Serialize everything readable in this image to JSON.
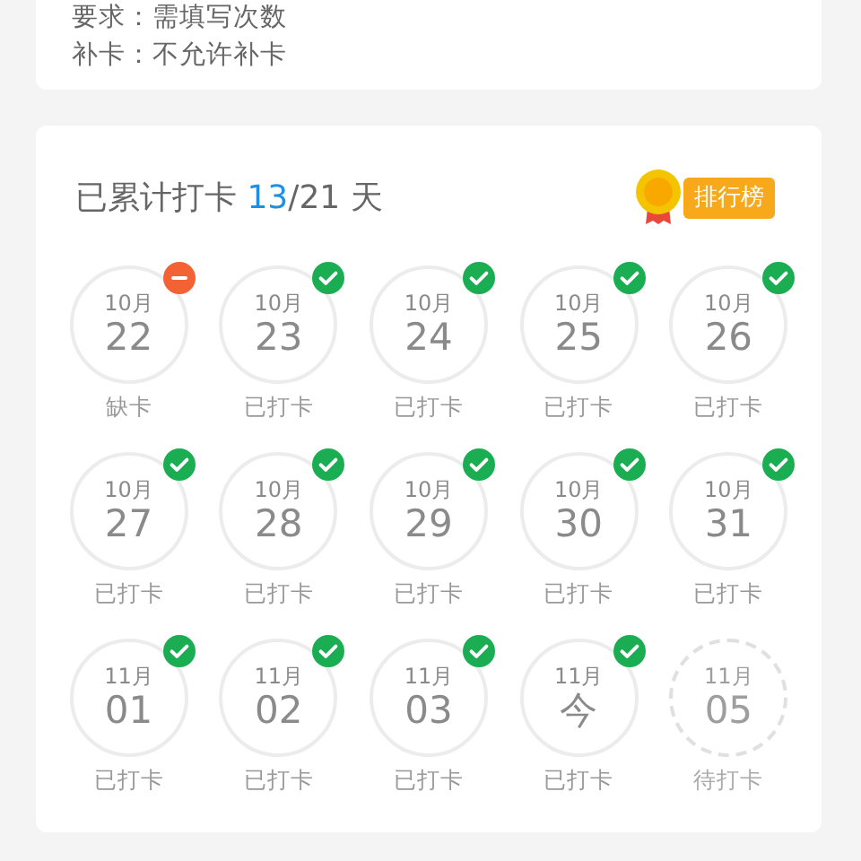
{
  "info_card": {
    "lines": [
      {
        "label": "要求：",
        "value": "需填写次数"
      },
      {
        "label": "补卡：",
        "value": "不允许补卡"
      }
    ]
  },
  "checkin": {
    "title_prefix": "已累计打卡",
    "done_count": "13",
    "total": "/21 天",
    "leaderboard_button": "排行榜",
    "days": [
      {
        "month": "10月",
        "day": "22",
        "status": "缺卡",
        "kind": "missed"
      },
      {
        "month": "10月",
        "day": "23",
        "status": "已打卡",
        "kind": "done"
      },
      {
        "month": "10月",
        "day": "24",
        "status": "已打卡",
        "kind": "done"
      },
      {
        "month": "10月",
        "day": "25",
        "status": "已打卡",
        "kind": "done"
      },
      {
        "month": "10月",
        "day": "26",
        "status": "已打卡",
        "kind": "done"
      },
      {
        "month": "10月",
        "day": "27",
        "status": "已打卡",
        "kind": "done"
      },
      {
        "month": "10月",
        "day": "28",
        "status": "已打卡",
        "kind": "done"
      },
      {
        "month": "10月",
        "day": "29",
        "status": "已打卡",
        "kind": "done"
      },
      {
        "month": "10月",
        "day": "30",
        "status": "已打卡",
        "kind": "done"
      },
      {
        "month": "10月",
        "day": "31",
        "status": "已打卡",
        "kind": "done"
      },
      {
        "month": "11月",
        "day": "01",
        "status": "已打卡",
        "kind": "done"
      },
      {
        "month": "11月",
        "day": "02",
        "status": "已打卡",
        "kind": "done"
      },
      {
        "month": "11月",
        "day": "03",
        "status": "已打卡",
        "kind": "done"
      },
      {
        "month": "11月",
        "day": "今",
        "status": "已打卡",
        "kind": "done"
      },
      {
        "month": "11月",
        "day": "05",
        "status": "待打卡",
        "kind": "pending"
      }
    ]
  }
}
